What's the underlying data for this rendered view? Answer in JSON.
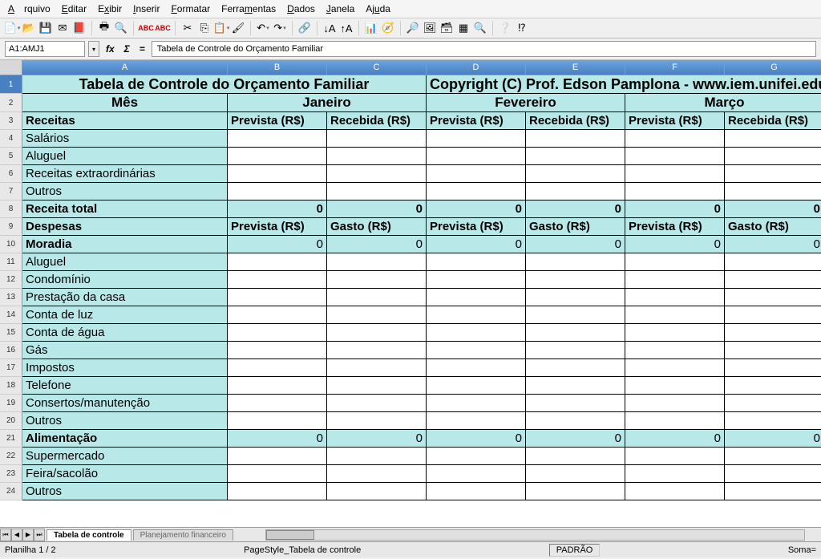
{
  "menu": [
    "Arquivo",
    "Editar",
    "Exibir",
    "Inserir",
    "Formatar",
    "Ferramentas",
    "Dados",
    "Janela",
    "Ajuda"
  ],
  "cellref": "A1:AMJ1",
  "formula": "Tabela de Controle do Orçamento Familiar",
  "cols": [
    "A",
    "B",
    "C",
    "D",
    "E",
    "F",
    "G"
  ],
  "title_left": "Tabela de Controle do Orçamento Familiar",
  "title_right": "Copyright (C) Prof. Edson Pamplona - www.iem.unifei.edu.br/e",
  "hdr_mes": "Mês",
  "months": [
    "Janeiro",
    "Fevereiro",
    "Março"
  ],
  "lbl_receitas": "Receitas",
  "lbl_prevista": "Prevista (R$)",
  "lbl_recebida": "Recebida (R$)",
  "lbl_gasto": "Gasto (R$)",
  "rows_receitas": [
    "Salários",
    "Aluguel",
    "Receitas extraordinárias",
    "Outros"
  ],
  "lbl_receita_total": "Receita total",
  "lbl_despesas": "Despesas",
  "lbl_moradia": "Moradia",
  "rows_moradia": [
    "Aluguel",
    "Condomínio",
    "Prestação da casa",
    "Conta de luz",
    "Conta de água",
    "Gás",
    "Impostos",
    "Telefone",
    "Consertos/manutenção",
    "Outros"
  ],
  "lbl_alimentacao": "Alimentação",
  "rows_alimentacao": [
    "Supermercado",
    "Feira/sacolão",
    "Outros"
  ],
  "zero": "0",
  "tabs": [
    "Tabela de controle",
    "Planejamento financeiro"
  ],
  "status_sheet": "Planilha 1 / 2",
  "status_style": "PageStyle_Tabela de controle",
  "status_mode": "PADRÃO",
  "status_sum": "Soma=",
  "chart_data": {
    "type": "table",
    "title": "Tabela de Controle do Orçamento Familiar",
    "columns": [
      "Mês",
      "Janeiro Prevista (R$)",
      "Janeiro Recebida (R$)",
      "Fevereiro Prevista (R$)",
      "Fevereiro Recebida (R$)",
      "Março Prevista (R$)",
      "Março Recebida (R$)"
    ],
    "sections": [
      {
        "name": "Receitas",
        "items": [
          "Salários",
          "Aluguel",
          "Receitas extraordinárias",
          "Outros"
        ],
        "total_label": "Receita total",
        "totals": [
          0,
          0,
          0,
          0,
          0,
          0
        ]
      },
      {
        "name": "Despesas",
        "sub": [
          {
            "name": "Moradia",
            "totals": [
              0,
              0,
              0,
              0,
              0,
              0
            ],
            "items": [
              "Aluguel",
              "Condomínio",
              "Prestação da casa",
              "Conta de luz",
              "Conta de água",
              "Gás",
              "Impostos",
              "Telefone",
              "Consertos/manutenção",
              "Outros"
            ]
          },
          {
            "name": "Alimentação",
            "totals": [
              0,
              0,
              0,
              0,
              0,
              0
            ],
            "items": [
              "Supermercado",
              "Feira/sacolão",
              "Outros"
            ]
          }
        ]
      }
    ]
  }
}
